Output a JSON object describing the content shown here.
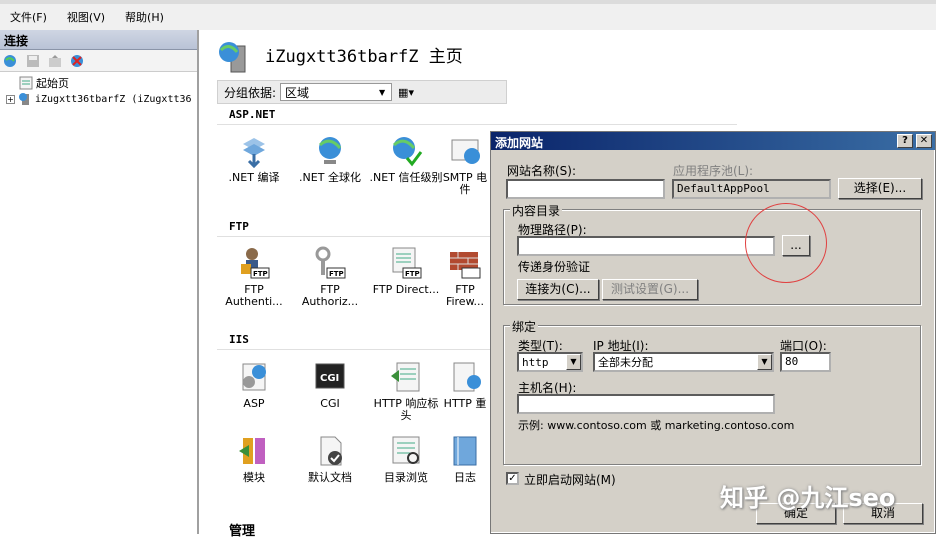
{
  "menubar": {
    "items": [
      "文件(F)",
      "视图(V)",
      "帮助(H)"
    ]
  },
  "connections": {
    "header": "连接",
    "tree": {
      "start_page": "起始页",
      "server": "iZugxtt36tbarfZ (iZugxtt36"
    }
  },
  "main": {
    "title": "iZugxtt36tbarfZ 主页",
    "group_label": "分组依据:",
    "group_value": "区域",
    "sections": {
      "aspnet": "ASP.NET",
      "ftp": "FTP",
      "iis": "IIS",
      "manage": "管理"
    },
    "features": {
      "net_compile": ".NET 编译",
      "net_global": ".NET 全球化",
      "net_trust": ".NET 信任级别",
      "smtp": "SMTP 电件",
      "ftp_auth": "FTP Authenti...",
      "ftp_authz": "FTP Authoriz...",
      "ftp_dir": "FTP Direct...",
      "ftp_fw": "FTP Firew...",
      "asp": "ASP",
      "cgi": "CGI",
      "http_resp": "HTTP 响应标头",
      "http_redir": "HTTP 重",
      "modules": "模块",
      "default_doc": "默认文档",
      "dir_browse": "目录浏览",
      "logging": "日志"
    }
  },
  "dialog": {
    "title": "添加网站",
    "site_name_label": "网站名称(S):",
    "site_name_value": "",
    "app_pool_label": "应用程序池(L):",
    "app_pool_value": "DefaultAppPool",
    "select_button": "选择(E)...",
    "content_dir_group": "内容目录",
    "physical_path_label": "物理路径(P):",
    "physical_path_value": "",
    "browse_button": "...",
    "pass_through_label": "传递身份验证",
    "connect_as_button": "连接为(C)...",
    "test_settings_button": "测试设置(G)...",
    "binding_group": "绑定",
    "type_label": "类型(T):",
    "type_value": "http",
    "ip_label": "IP 地址(I):",
    "ip_value": "全部未分配",
    "port_label": "端口(O):",
    "port_value": "80",
    "hostname_label": "主机名(H):",
    "hostname_value": "",
    "example_text": "示例: www.contoso.com 或 marketing.contoso.com",
    "start_site_label": "立即启动网站(M)",
    "start_site_checked": true,
    "ok_button": "确定",
    "cancel_button": "取消"
  },
  "watermark": "知乎 @九江seo"
}
